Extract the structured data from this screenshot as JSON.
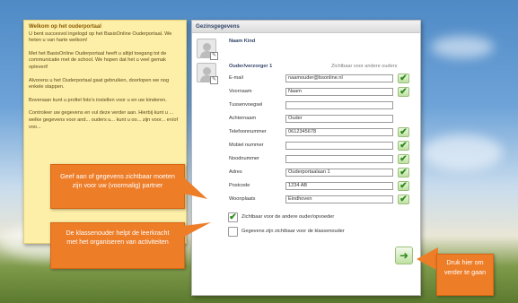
{
  "welcome": {
    "title": "Welkom op het ouderportaal",
    "p1": "U bent succesvol ingelogd op het BasisOnline Ouderportaal. We heten u van harte welkom!",
    "p2": "Met het BasisOnline Ouderportaal heeft u altijd toegang tot de communicatie met de school. We hopen dat het u veel gemak oplevert!",
    "p3": "Alvorens u het Ouderportaal gaat gebruiken, doorlopen we nog enkele stappen.",
    "p4": "Bovenaan kunt u profiel foto's instellen voor u en uw kinderen.",
    "p5": "Controleer uw gegevens en vul deze verder aan. Hierbij kunt u ... welke gegevens voor and... ouders u... kunt u oo... zijn voor... en/of voo..."
  },
  "panel": {
    "title": "Gezinsgegevens",
    "child_name": "Naam Kind",
    "parent_heading": "Ouder/verzorger 1",
    "visibility_heading": "Zichtbaar voor andere ouders",
    "fields": [
      {
        "label": "E-mail",
        "value": "naamouder@bsonline.nl",
        "checked": true
      },
      {
        "label": "Voornaam",
        "value": "Naam",
        "checked": true
      },
      {
        "label": "Tussenvoegsel",
        "value": "",
        "checked": false
      },
      {
        "label": "Achternaam",
        "value": "Ouder",
        "checked": false
      },
      {
        "label": "Telefoonnummer",
        "value": "0612345678",
        "checked": true
      },
      {
        "label": "Mobiel nummer",
        "value": "",
        "checked": true
      },
      {
        "label": "Noodnummer",
        "value": "",
        "checked": true
      },
      {
        "label": "Adres",
        "value": "Ouderportaalaan 1",
        "checked": true
      },
      {
        "label": "Postcode",
        "value": "1234 AB",
        "checked": true
      },
      {
        "label": "Woonplaats",
        "value": "Eindhoven",
        "checked": true
      }
    ],
    "checkbox1": "Zichtbaar voor de andere ouder/opvoeder",
    "checkbox2": "Gegevens zijn zichtbaar voor de klassenouder"
  },
  "callouts": {
    "partner": "Geef aan of gegevens zichtbaar moeten zijn voor uw (voormalig) partner",
    "klassenouder": "De klassenouder helpt de leerkracht met het organiseren van activiteiten",
    "next": "Druk hier om verder te gaan"
  },
  "icons": {
    "check": "check-icon",
    "arrow": "arrow-right-icon",
    "avatar": "avatar-placeholder-icon"
  },
  "colors": {
    "callout": "#ee7d28",
    "check": "#2e8a1e",
    "note": "#fdeea8"
  }
}
